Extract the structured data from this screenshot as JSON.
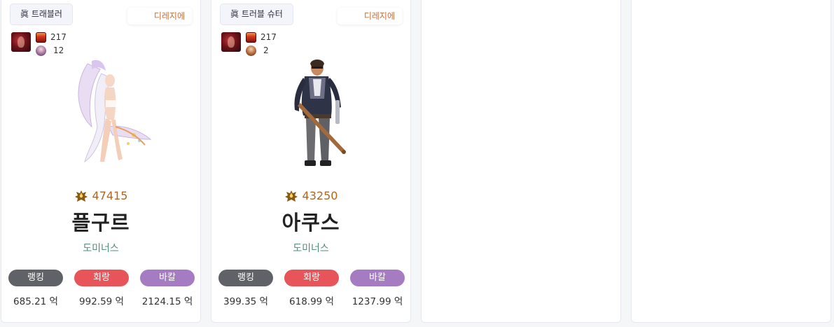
{
  "cards": [
    {
      "job": "眞 트래블러",
      "server": "디레지에",
      "stat1_value": "217",
      "stat2_value": "12",
      "fame": "47415",
      "name": "플구르",
      "adventure": "도미너스",
      "rankings": [
        {
          "label": "랭킹",
          "value": "685.21 억"
        },
        {
          "label": "회랑",
          "value": "992.59 억"
        },
        {
          "label": "바칼",
          "value": "2124.15 억"
        }
      ]
    },
    {
      "job": "眞 트러블 슈터",
      "server": "디레지에",
      "stat1_value": "217",
      "stat2_value": "2",
      "fame": "43250",
      "name": "아쿠스",
      "adventure": "도미너스",
      "rankings": [
        {
          "label": "랭킹",
          "value": "399.35 억"
        },
        {
          "label": "회랑",
          "value": "618.99 억"
        },
        {
          "label": "바칼",
          "value": "1237.99 억"
        }
      ]
    }
  ],
  "icons": {
    "buff_avatar": "buff-avatar-icon",
    "stat1": "weapon-icon",
    "stat2": "aura-icon",
    "fame": "fame-crest-icon"
  },
  "colors": {
    "fame": "#b5651d",
    "server": "#c2703a",
    "adventure": "#4d8f7d",
    "rank_pill_1": "#5f6266",
    "rank_pill_2": "#e7555a",
    "rank_pill_3": "#a57bc1"
  }
}
